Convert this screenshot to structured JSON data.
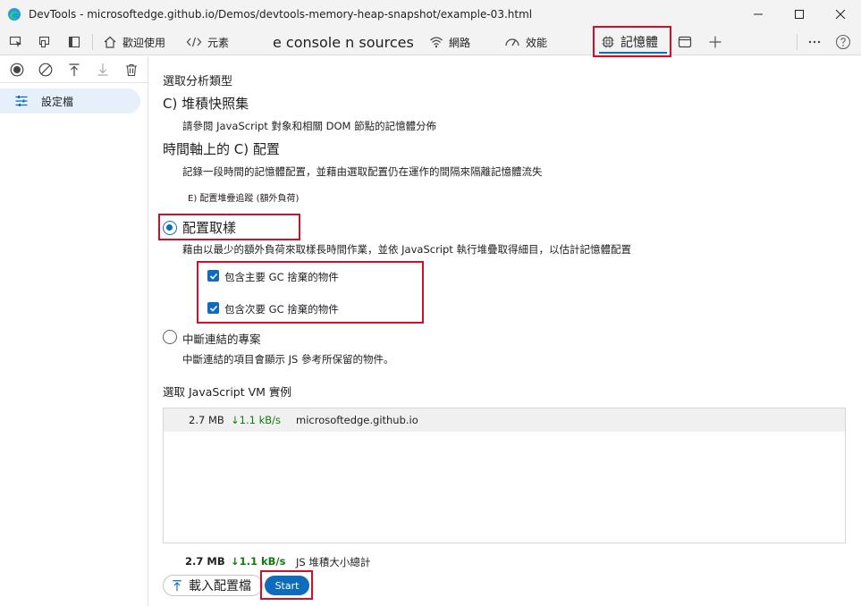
{
  "window": {
    "title": "DevTools - microsoftedge.github.io/Demos/devtools-memory-heap-snapshot/example-03.html"
  },
  "tabs": {
    "welcome": "歡迎使用",
    "elements": "元素",
    "console_sources": "e console n sources",
    "network": "網路",
    "performance": "效能",
    "memory": "記憶體"
  },
  "sidebar": {
    "profiles_label": "設定檔"
  },
  "memory": {
    "select_type": "選取分析類型",
    "heap_snapshot": {
      "title": "C) 堆積快照集",
      "description": "請參閱 JavaScript 對象和相關 DOM 節點的記憶體分佈"
    },
    "timeline": {
      "title": "時間軸上的 C) 配置",
      "description": "記錄一段時間的記憶體配置，並藉由選取配置仍在運作的間隔來隔離記憶體流失",
      "option": "E) 配置堆疊追蹤 (額外負荷)"
    },
    "sampling": {
      "title": "配置取樣",
      "description": "藉由以最少的額外負荷來取樣長時間作業，並依 JavaScript 執行堆疊取得細目，以估計記憶體配置",
      "checkbox_major": "包含主要 GC 捨棄的物件",
      "checkbox_minor": "包含次要 GC 捨棄的物件"
    },
    "detached": {
      "title": "中斷連結的專案",
      "description": "中斷連結的項目會顯示 JS 參考所保留的物件。"
    },
    "vm_select_label": "選取 JavaScript VM 實例",
    "vm_instances": [
      {
        "size": "2.7 MB",
        "rate": "↓1.1 kB/s",
        "name": "microsoftedge.github.io"
      }
    ],
    "footer": {
      "size": "2.7 MB",
      "rate": "↓1.1 kB/s",
      "label": "JS 堆積大小總計"
    },
    "load_button": "載入配置檔",
    "start_button": "Start"
  },
  "colors": {
    "accent": "#0f6cbd",
    "highlight": "#d0102b"
  }
}
